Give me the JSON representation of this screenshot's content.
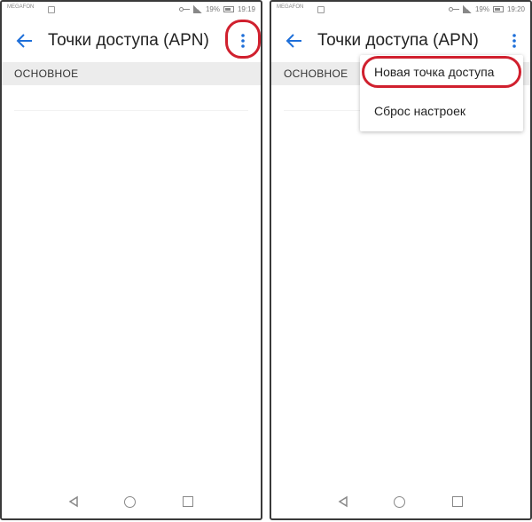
{
  "left_phone": {
    "status": {
      "carrier": "MEGAFON",
      "time": "19:19",
      "battery": "19%"
    },
    "toolbar": {
      "title": "Точки доступа (APN)"
    },
    "section": {
      "label": "ОСНОВНОЕ"
    }
  },
  "right_phone": {
    "status": {
      "carrier": "MEGAFON",
      "time": "19:20",
      "battery": "19%"
    },
    "toolbar": {
      "title": "Точки доступа (APN)"
    },
    "section": {
      "label": "ОСНОВНОЕ"
    },
    "menu": {
      "items": [
        {
          "label": "Новая точка доступа"
        },
        {
          "label": "Сброс настроек"
        }
      ]
    }
  },
  "icons": [
    "back-arrow-icon",
    "more-vert-icon",
    "key-icon",
    "signal-icon",
    "battery-icon",
    "nav-back-icon",
    "nav-home-icon",
    "nav-recent-icon"
  ],
  "colors": {
    "accent": "#1e6fd9",
    "highlight": "#d0202e",
    "section_bg": "#ececec"
  }
}
